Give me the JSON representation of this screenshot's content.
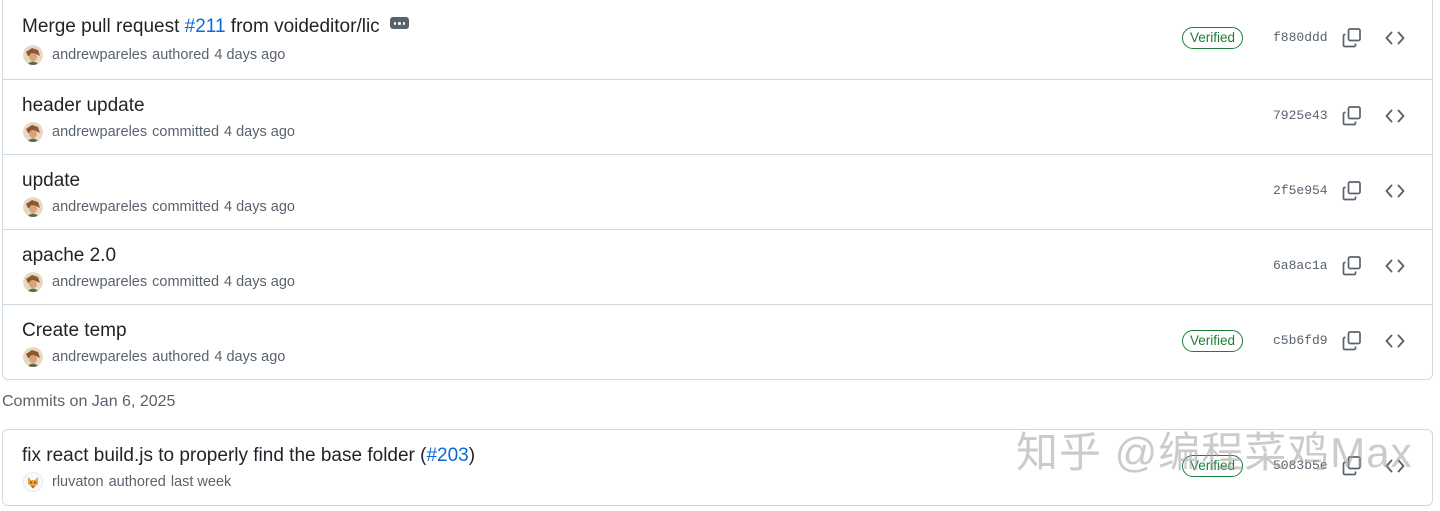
{
  "group1": {
    "commits": [
      {
        "message": "Merge pull request ",
        "pr": "#211",
        "message_suffix": " from voideditor/lic",
        "author": "andrewpareles",
        "action": "authored",
        "time": "4 days ago",
        "verified": "Verified",
        "sha": "f880ddd"
      },
      {
        "message": "header update",
        "author": "andrewpareles",
        "action": "committed",
        "time": "4 days ago",
        "sha": "7925e43"
      },
      {
        "message": "update",
        "author": "andrewpareles",
        "action": "committed",
        "time": "4 days ago",
        "sha": "2f5e954"
      },
      {
        "message": "apache 2.0",
        "author": "andrewpareles",
        "action": "committed",
        "time": "4 days ago",
        "sha": "6a8ac1a"
      },
      {
        "message": "Create temp",
        "author": "andrewpareles",
        "action": "authored",
        "time": "4 days ago",
        "verified": "Verified",
        "sha": "c5b6fd9"
      }
    ]
  },
  "date_header": "Commits on Jan 6, 2025",
  "group2": {
    "commits": [
      {
        "message": "fix react build.js to properly find the base folder (",
        "pr": "#203",
        "message_suffix": ")",
        "author": "rluvaton",
        "action": "authored",
        "time": "last week",
        "verified": "Verified",
        "sha": "5083b5e"
      }
    ]
  },
  "watermark": "知乎 @编程菜鸡Max",
  "icons": {
    "copy": "copy-icon",
    "browse": "code-icon",
    "ellipsis": "kebab-horizontal-icon"
  },
  "colors": {
    "link": "#0969da",
    "verified": "#1a7f37",
    "muted": "#59636e",
    "border": "#d1d9e0"
  }
}
